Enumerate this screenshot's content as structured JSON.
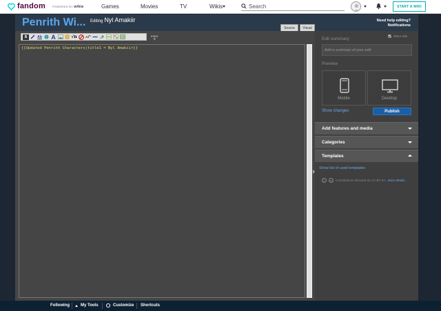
{
  "topnav": {
    "brand": "fandom",
    "powered_by": "POWERED BY",
    "powered_brand": "wikia",
    "links": [
      "Games",
      "Movies",
      "TV",
      "Wikis"
    ],
    "search_placeholder": "Search",
    "start_wiki": "START A WIKI"
  },
  "editor": {
    "wiki_title": "Penrith Wi...",
    "editing_label": "Editing",
    "page_name": "Nyl Amakiir",
    "help_text": "Need help editing?",
    "notifications": "Notifications",
    "tabs": [
      "Source",
      "Visual"
    ],
    "more_label": "more",
    "content": "{{Updated Penrith Characters|title1 = Nyl Amakiir}}"
  },
  "toolbar_icons": [
    "bold-icon",
    "italic-icon",
    "link-icon",
    "external-link-icon",
    "headline-icon",
    "image-icon",
    "media-icon",
    "math-icon",
    "nowiki-icon",
    "signature-icon",
    "horizontal-line-icon",
    "redirect-icon",
    "strike-icon",
    "gallery-icon",
    "table-icon"
  ],
  "rail": {
    "edit_summary": "Edit summary",
    "minor_edit": "Minor edit",
    "summary_placeholder": "Add a summary of your edit",
    "preview": "Preview",
    "mobile": "Mobile",
    "desktop": "Desktop",
    "show_changes": "Show changes",
    "publish": "Publish",
    "sections": [
      "Add features and media",
      "Categories",
      "Templates"
    ],
    "used_templates": "Show list of used templates",
    "license_text": "Contributions licensed as CC-BY-SA.",
    "more_details": "More details."
  },
  "bottombar": {
    "following": "Following",
    "my_tools": "My Tools",
    "customize": "Customize",
    "shortcuts": "Shortcuts"
  },
  "colors": {
    "accent": "#00acac",
    "link": "#6aa9e6",
    "publish": "#1a5fa6",
    "header_bg": "#2b3a4a"
  }
}
